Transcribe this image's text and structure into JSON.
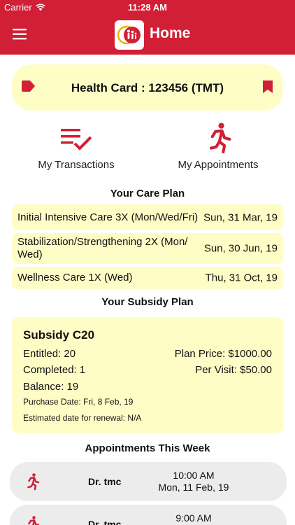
{
  "status_bar": {
    "carrier": "Carrier",
    "time": "11:28 AM"
  },
  "nav": {
    "title": "Home"
  },
  "health_card": {
    "text": "Health Card : 123456 (TMT)"
  },
  "quick_actions": [
    {
      "label": "My Transactions",
      "icon": "checklist-icon"
    },
    {
      "label": "My Appointments",
      "icon": "running-person-icon"
    }
  ],
  "care_plan": {
    "title": "Your Care Plan",
    "items": [
      {
        "name": "Initial Intensive Care 3X (Mon/Wed/Fri)",
        "date": "Sun, 31 Mar, 19"
      },
      {
        "name": "Stabilization/Strengthening 2X (Mon/ Wed)",
        "date": "Sun, 30 Jun, 19"
      },
      {
        "name": "Wellness Care 1X (Wed)",
        "date": "Thu, 31 Oct, 19"
      }
    ]
  },
  "subsidy_plan": {
    "title": "Your Subsidy Plan",
    "name": "Subsidy C20",
    "entitled": "Entitled: 20",
    "completed": "Completed: 1",
    "balance": "Balance: 19",
    "plan_price": "Plan Price: $1000.00",
    "per_visit": "Per Visit: $50.00",
    "purchase_date": "Purchase Date: Fri, 8 Feb, 19",
    "renewal": "Estimated date for renewal: N/A"
  },
  "appointments": {
    "title": "Appointments This Week",
    "items": [
      {
        "doctor": "Dr. tmc",
        "time": "10:00 AM",
        "date": "Mon, 11 Feb, 19"
      },
      {
        "doctor": "Dr. tmc",
        "time": "9:00 AM",
        "date": ""
      }
    ]
  },
  "colors": {
    "brand_red": "#d11f35",
    "card_yellow": "#fffdc6",
    "appointment_gray": "#ececec"
  }
}
